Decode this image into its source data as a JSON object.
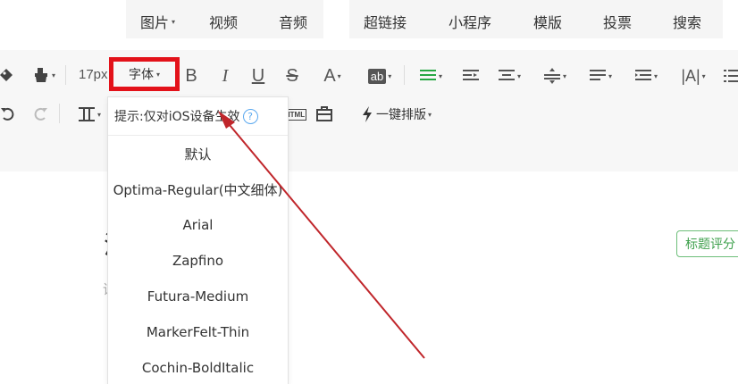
{
  "topnav": {
    "group1": [
      {
        "label": "图片",
        "dropdown": true
      },
      {
        "label": "视频",
        "dropdown": false
      },
      {
        "label": "音频",
        "dropdown": false
      }
    ],
    "group2": [
      {
        "label": "超链接"
      },
      {
        "label": "小程序"
      },
      {
        "label": "模版"
      },
      {
        "label": "投票"
      },
      {
        "label": "搜索"
      }
    ]
  },
  "toolbar": {
    "font_size": "17px",
    "font_family_label": "字体",
    "letters": {
      "bold": "B",
      "italic": "I",
      "underline": "U",
      "strike": "S",
      "font_color": "A",
      "bg_color": "ab",
      "line_height": "|A|"
    },
    "one_key_format": "一键排版",
    "html_label": "HTML",
    "accent_color": "#27a844",
    "highlight_border": "#e3121a"
  },
  "font_dropdown": {
    "tip": "提示:仅对iOS设备生效",
    "help_glyph": "?",
    "options": [
      "默认",
      "Optima-Regular(中文细体)",
      "Arial",
      "Zapfino",
      "Futura-Medium",
      "MarkerFelt-Thin",
      "Cochin-BoldItalic"
    ]
  },
  "editor": {
    "frag1": "洋",
    "frag2": "请",
    "score_button": "标题评分"
  },
  "annotation_arrow_color": "#c0262b"
}
